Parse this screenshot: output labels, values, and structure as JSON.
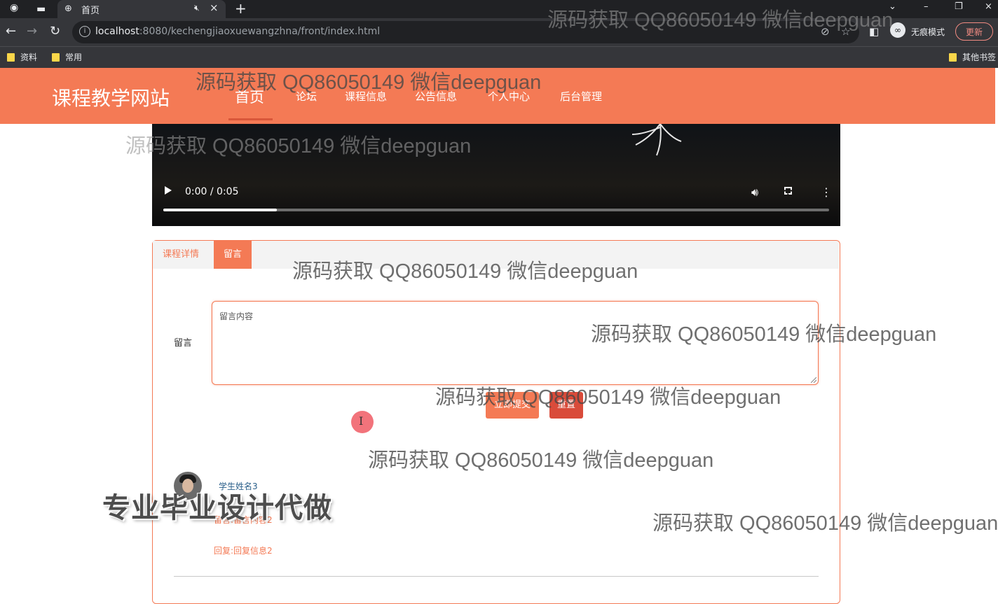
{
  "browser": {
    "tab_title": "首页",
    "url_host": "localhost",
    "url_rest": ":8080/kechengjiaoxuewangzhna/front/index.html",
    "incognito_label": "无痕模式",
    "update_label": "更新",
    "bookmarks": [
      "资料",
      "常用"
    ],
    "other_bookmarks": "其他书签"
  },
  "site": {
    "title": "课程教学网站",
    "nav": [
      "首页",
      "论坛",
      "课程信息",
      "公告信息",
      "个人中心",
      "后台管理"
    ],
    "active_nav_index": 0
  },
  "video": {
    "time": "0:00 / 0:05",
    "progress_fraction": 0.17
  },
  "panel": {
    "tabs": [
      "课程详情",
      "留言"
    ],
    "active_tab": "留言",
    "form_label": "留言",
    "textarea_placeholder": "留言内容",
    "submit_label": "立即提交",
    "reset_label": "重置",
    "comment": {
      "name": "学生姓名3",
      "message": "留言:留言内容2",
      "reply": "回复:回复信息2"
    }
  },
  "watermarks": {
    "text": "源码获取 QQ86050149 微信deepguan",
    "banner": "专业毕业设计代做"
  },
  "colors": {
    "accent": "#f47a55",
    "reset": "#d94b3a",
    "chrome_dark": "#202124",
    "chrome_mid": "#35363a"
  }
}
